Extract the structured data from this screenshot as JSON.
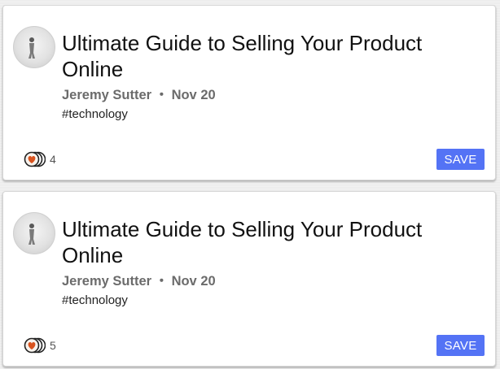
{
  "cards": [
    {
      "title": "Ultimate Guide to Selling Your Product Online",
      "author": "Jeremy Sutter",
      "separator": "・",
      "date": "Nov 20",
      "tag": "#technology",
      "reaction_count": "4",
      "save_label": "SAVE"
    },
    {
      "title": "Ultimate Guide to Selling Your Product Online",
      "author": "Jeremy Sutter",
      "separator": "・",
      "date": "Nov 20",
      "tag": "#technology",
      "reaction_count": "5",
      "save_label": "SAVE"
    }
  ],
  "colors": {
    "save_button": "#5473f5",
    "heart": "#d9531e"
  },
  "icons": {
    "avatar": "author-avatar",
    "reaction": "heart-reactions-icon"
  }
}
